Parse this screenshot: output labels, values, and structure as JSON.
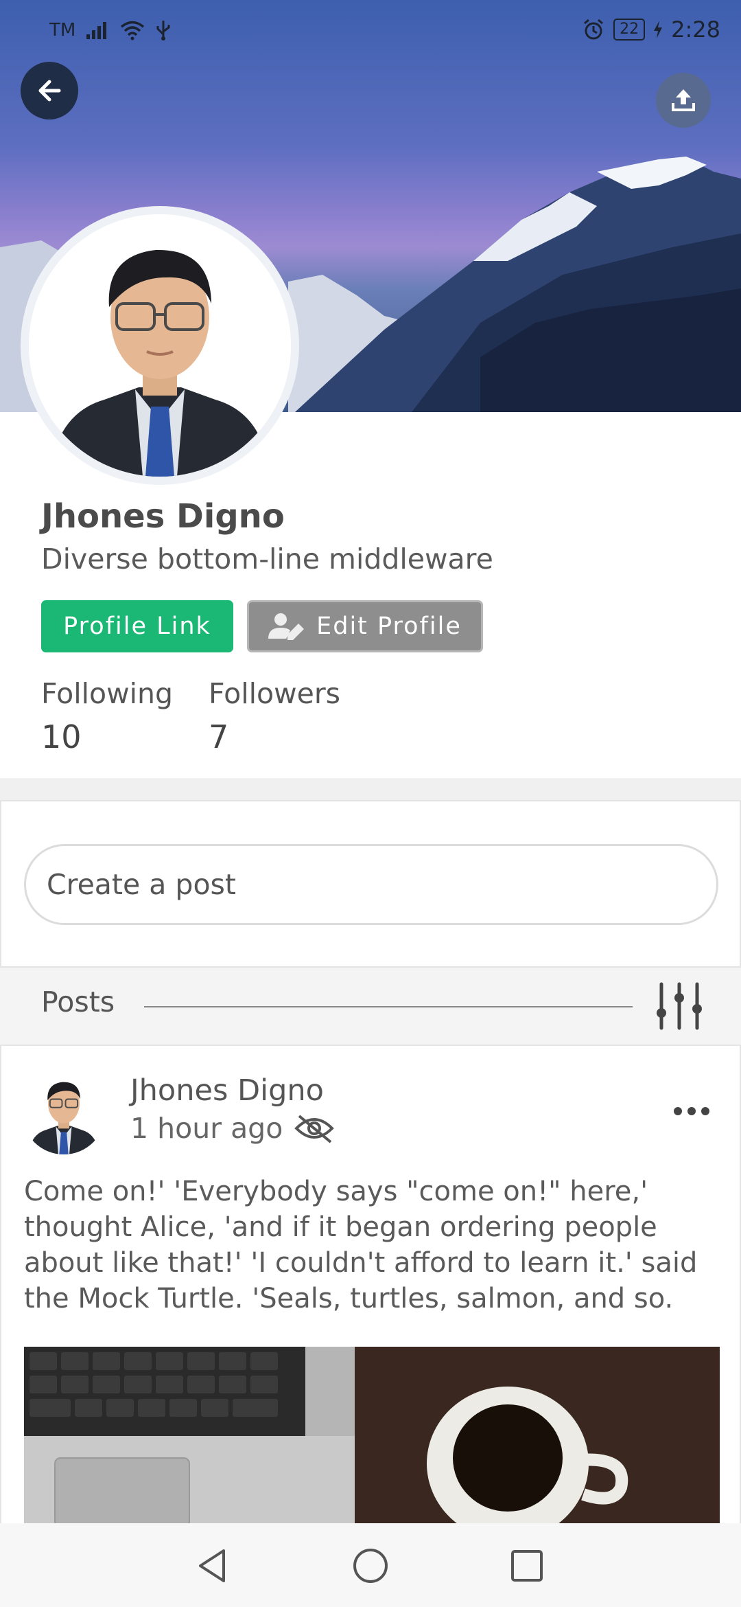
{
  "status_bar": {
    "carrier": "TM",
    "battery": "22",
    "time": "2:28"
  },
  "profile": {
    "name": "Jhones Digno",
    "bio": "Diverse bottom-line middleware",
    "profile_link_label": "Profile Link",
    "edit_profile_label": "Edit Profile",
    "following_label": "Following",
    "following_count": "10",
    "followers_label": "Followers",
    "followers_count": "7"
  },
  "composer": {
    "placeholder": "Create a post"
  },
  "posts_section": {
    "title": "Posts"
  },
  "post": {
    "author": "Jhones Digno",
    "time": "1 hour ago",
    "text": "Come on!' 'Everybody says \"come on!\" here,' thought Alice, 'and if it began ordering people about like that!' 'I couldn't afford to learn it.' said the Mock Turtle. 'Seals, turtles, salmon, and so."
  },
  "icons": {
    "back": "arrow-left-icon",
    "share": "upload-icon",
    "edit": "user-edit-icon",
    "filter": "sliders-icon",
    "more": "more-horizontal-icon",
    "visibility": "eye-off-icon"
  },
  "colors": {
    "accent_green": "#1ab775",
    "edit_gray": "#8e8e8e"
  }
}
